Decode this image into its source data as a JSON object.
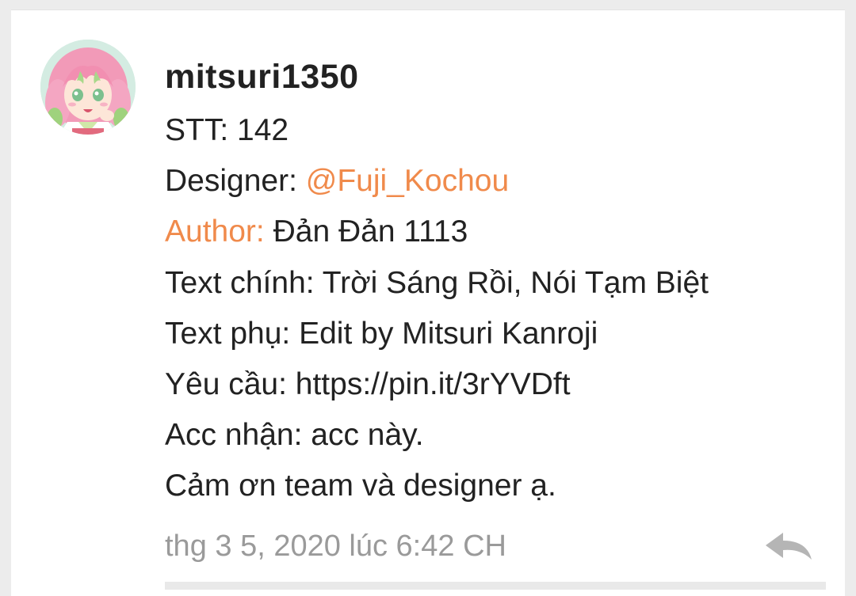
{
  "comment": {
    "username": "mitsuri1350",
    "stt_line": "STT: 142",
    "designer_label": "Designer: ",
    "designer_mention": "@Fuji_Kochou",
    "author_label": "Author:",
    "author_value": " Đản Đản 1113",
    "text_chinh": "Text chính: Trời Sáng Rồi, Nói Tạm Biệt",
    "text_phu": "Text phụ: Edit by Mitsuri Kanroji",
    "yeu_cau": "Yêu cầu: https://pin.it/3rYVDft",
    "acc_nhan": "Acc nhận: acc này.",
    "cam_on": "Cảm ơn team và designer ạ.",
    "timestamp": "thg 3 5, 2020 lúc 6:42 CH"
  },
  "icons": {
    "avatar": "anime-avatar-image",
    "reply": "reply-arrow-icon"
  },
  "colors": {
    "accent": "#f08a4b",
    "text": "#222222",
    "muted": "#9a9a9a"
  }
}
